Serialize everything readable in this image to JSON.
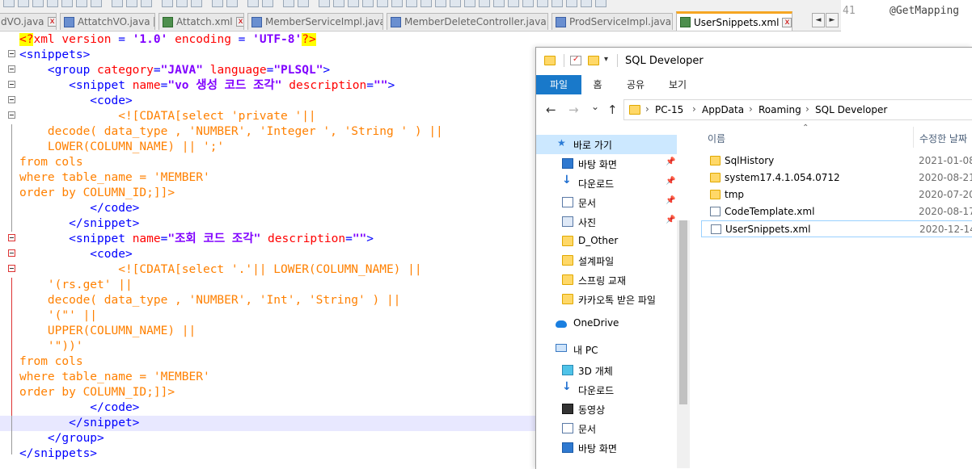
{
  "editor": {
    "tabs": [
      {
        "label": "dVO.java",
        "type": "java"
      },
      {
        "label": "AttatchVO.java",
        "type": "java"
      },
      {
        "label": "Attatch.xml",
        "type": "xml"
      },
      {
        "label": "MemberServiceImpl.java",
        "type": "java"
      },
      {
        "label": "MemberDeleteController.java",
        "type": "java"
      },
      {
        "label": "ProdServiceImpl.java",
        "type": "java"
      },
      {
        "label": "UserSnippets.xml",
        "type": "xml",
        "active": true
      }
    ],
    "tab_close": "x",
    "scroll_left": "◄",
    "scroll_right": "►",
    "side_code": {
      "line_no": "41",
      "text": "@GetMapping"
    },
    "lines": [
      [
        {
          "t": "<?",
          "c": "pi"
        },
        {
          "t": "xml ",
          "c": "attr"
        },
        {
          "t": "version",
          "c": "attr"
        },
        {
          "t": " = ",
          "c": "tag"
        },
        {
          "t": "'1.0'",
          "c": "val"
        },
        {
          "t": " ",
          "c": "tag"
        },
        {
          "t": "encoding",
          "c": "attr"
        },
        {
          "t": " = ",
          "c": "tag"
        },
        {
          "t": "'UTF-8'",
          "c": "val"
        },
        {
          "t": "?>",
          "c": "pi"
        }
      ],
      [
        {
          "t": "<snippets>",
          "c": "tag"
        }
      ],
      [
        {
          "t": "    <group ",
          "c": "tag"
        },
        {
          "t": "category",
          "c": "attr"
        },
        {
          "t": "=",
          "c": "tag"
        },
        {
          "t": "\"JAVA\"",
          "c": "val"
        },
        {
          "t": " ",
          "c": "tag"
        },
        {
          "t": "language",
          "c": "attr"
        },
        {
          "t": "=",
          "c": "tag"
        },
        {
          "t": "\"PLSQL\"",
          "c": "val"
        },
        {
          "t": ">",
          "c": "tag"
        }
      ],
      [
        {
          "t": "       <snippet ",
          "c": "tag"
        },
        {
          "t": "name",
          "c": "attr"
        },
        {
          "t": "=",
          "c": "tag"
        },
        {
          "t": "\"vo 생성 코드 조각\"",
          "c": "val"
        },
        {
          "t": " ",
          "c": "tag"
        },
        {
          "t": "description",
          "c": "attr"
        },
        {
          "t": "=",
          "c": "tag"
        },
        {
          "t": "\"\"",
          "c": "val"
        },
        {
          "t": ">",
          "c": "tag"
        }
      ],
      [
        {
          "t": "          <code>",
          "c": "tag"
        }
      ],
      [
        {
          "t": "              <![CDATA[select 'private '||",
          "c": "cd"
        }
      ],
      [
        {
          "t": "    decode( data_type , 'NUMBER', 'Integer ', 'String ' ) ||",
          "c": "cd"
        }
      ],
      [
        {
          "t": "    LOWER(COLUMN_NAME) || ';'",
          "c": "cd"
        }
      ],
      [
        {
          "t": "from cols",
          "c": "cd"
        }
      ],
      [
        {
          "t": "where table_name = 'MEMBER'",
          "c": "cd"
        }
      ],
      [
        {
          "t": "order by COLUMN_ID;]]>",
          "c": "cd"
        }
      ],
      [
        {
          "t": "          </code>",
          "c": "tag"
        }
      ],
      [
        {
          "t": "       </snippet>",
          "c": "tag"
        }
      ],
      [
        {
          "t": "       <snippet ",
          "c": "tag"
        },
        {
          "t": "name",
          "c": "attr"
        },
        {
          "t": "=",
          "c": "tag"
        },
        {
          "t": "\"조회 코드 조각\"",
          "c": "val"
        },
        {
          "t": " ",
          "c": "tag"
        },
        {
          "t": "description",
          "c": "attr"
        },
        {
          "t": "=",
          "c": "tag"
        },
        {
          "t": "\"\"",
          "c": "val"
        },
        {
          "t": ">",
          "c": "tag"
        }
      ],
      [
        {
          "t": "          <code>",
          "c": "tag"
        }
      ],
      [
        {
          "t": "              <![CDATA[select '.'|| LOWER(COLUMN_NAME) ||",
          "c": "cd"
        }
      ],
      [
        {
          "t": "    '(rs.get' ||",
          "c": "cd"
        }
      ],
      [
        {
          "t": "    decode( data_type , 'NUMBER', 'Int', 'String' ) ||",
          "c": "cd"
        }
      ],
      [
        {
          "t": "    '(\"' ||",
          "c": "cd"
        }
      ],
      [
        {
          "t": "    UPPER(COLUMN_NAME) ||",
          "c": "cd"
        }
      ],
      [
        {
          "t": "    '\"))'",
          "c": "cd"
        }
      ],
      [
        {
          "t": "from cols",
          "c": "cd"
        }
      ],
      [
        {
          "t": "where table_name = 'MEMBER'",
          "c": "cd"
        }
      ],
      [
        {
          "t": "order by COLUMN_ID;]]>",
          "c": "cd"
        }
      ],
      [
        {
          "t": "          </code>",
          "c": "tag"
        }
      ],
      [
        {
          "t": "       </snippet>",
          "c": "tag"
        }
      ],
      [
        {
          "t": "    </group>",
          "c": "tag"
        }
      ],
      [
        {
          "t": "</snippets>",
          "c": "tag"
        }
      ]
    ]
  },
  "explorer": {
    "title": "SQL Developer",
    "ribbon_tabs": [
      "파일",
      "홈",
      "공유",
      "보기"
    ],
    "nav": {
      "back": "←",
      "forward": "→",
      "recent": "⌄",
      "up": "↑"
    },
    "breadcrumbs": [
      "PC-15",
      "AppData",
      "Roaming",
      "SQL Developer"
    ],
    "breadcrumb_sep": "›",
    "columns": {
      "name": "이름",
      "modified": "수정한 날짜"
    },
    "sidebar": [
      {
        "label": "바로 가기",
        "icon": "star-icon",
        "selected": true
      },
      {
        "label": "바탕 화면",
        "icon": "desktop-icon",
        "pinned": true
      },
      {
        "label": "다운로드",
        "icon": "download-icon",
        "pinned": true
      },
      {
        "label": "문서",
        "icon": "document-icon",
        "pinned": true
      },
      {
        "label": "사진",
        "icon": "picture-icon",
        "pinned": true
      },
      {
        "label": "D_Other",
        "icon": "folder-icon"
      },
      {
        "label": "설계파일",
        "icon": "folder-icon"
      },
      {
        "label": "스프링 교재",
        "icon": "folder-icon"
      },
      {
        "label": "카카오톡 받은 파일",
        "icon": "folder-icon"
      },
      {
        "label": "OneDrive",
        "icon": "onedrive-icon"
      },
      {
        "label": "내 PC",
        "icon": "pc-icon"
      },
      {
        "label": "3D 개체",
        "icon": "cube-icon"
      },
      {
        "label": "다운로드",
        "icon": "download-icon"
      },
      {
        "label": "동영상",
        "icon": "video-icon"
      },
      {
        "label": "문서",
        "icon": "document-icon"
      },
      {
        "label": "바탕 화면",
        "icon": "desktop-icon"
      }
    ],
    "files": [
      {
        "name": "SqlHistory",
        "date": "2021-01-08",
        "type": "folder"
      },
      {
        "name": "system17.4.1.054.0712",
        "date": "2020-08-21",
        "type": "folder"
      },
      {
        "name": "tmp",
        "date": "2020-07-20",
        "type": "folder"
      },
      {
        "name": "CodeTemplate.xml",
        "date": "2020-08-17",
        "type": "xml"
      },
      {
        "name": "UserSnippets.xml",
        "date": "2020-12-14",
        "type": "xml",
        "selected": true
      }
    ]
  }
}
